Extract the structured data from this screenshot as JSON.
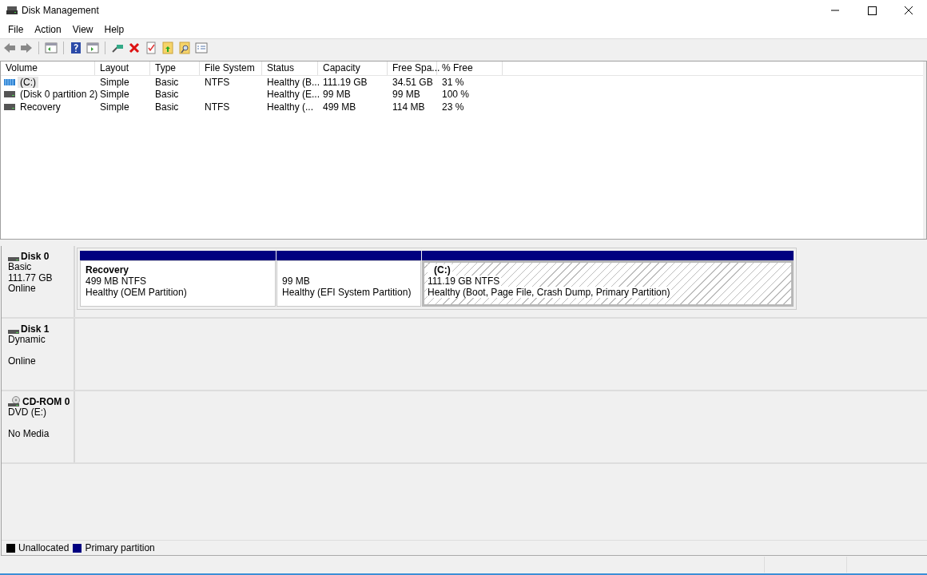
{
  "window": {
    "title": "Disk Management"
  },
  "menu": [
    "File",
    "Action",
    "View",
    "Help"
  ],
  "table": {
    "columns": [
      "Volume",
      "Layout",
      "Type",
      "File System",
      "Status",
      "Capacity",
      "Free Spa...",
      "% Free"
    ],
    "rows": [
      {
        "kind": "system",
        "selected": true,
        "cells": [
          "(C:)",
          "Simple",
          "Basic",
          "NTFS",
          "Healthy (B...",
          "111.19 GB",
          "34.51 GB",
          "31 %"
        ]
      },
      {
        "kind": "plain",
        "selected": false,
        "cells": [
          "(Disk 0 partition 2)",
          "Simple",
          "Basic",
          "",
          "Healthy (E...",
          "99 MB",
          "99 MB",
          "100 %"
        ]
      },
      {
        "kind": "plain",
        "selected": false,
        "cells": [
          "Recovery",
          "Simple",
          "Basic",
          "NTFS",
          "Healthy (...",
          "499 MB",
          "114 MB",
          "23 %"
        ]
      }
    ]
  },
  "disks": [
    {
      "kind": "disk",
      "name": "Disk 0",
      "type": "Basic",
      "capacity": "111.77 GB",
      "status": "Online",
      "partitions": [
        {
          "name": "Recovery",
          "size": "499 MB NTFS",
          "status": "Healthy (OEM Partition)",
          "selected": false
        },
        {
          "size": "99 MB",
          "status": "Healthy (EFI System Partition)",
          "selected": false
        },
        {
          "name": "(C:)",
          "size": "111.19 GB NTFS",
          "status": "Healthy (Boot, Page File, Crash Dump, Primary Partition)",
          "selected": true
        }
      ]
    },
    {
      "kind": "disk",
      "name": "Disk 1",
      "type": "Dynamic",
      "status": "Online"
    },
    {
      "kind": "cdrom",
      "name": "CD-ROM 0",
      "type": "DVD (E:)",
      "status": "No Media"
    }
  ],
  "legend": [
    {
      "label": "Unallocated",
      "color": "#000000"
    },
    {
      "label": "Primary partition",
      "color": "#000080"
    }
  ]
}
